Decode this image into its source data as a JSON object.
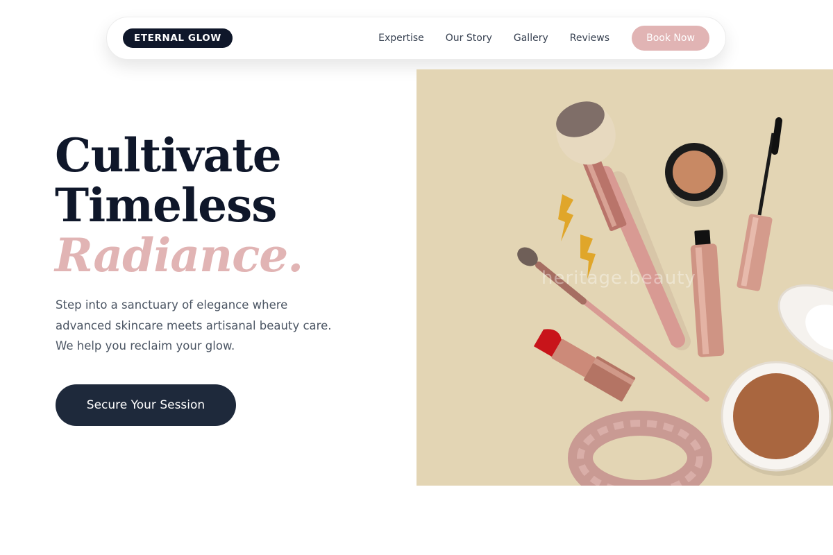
{
  "brand": {
    "name": "ETERNAL GLOW"
  },
  "nav": {
    "links": [
      "Expertise",
      "Our Story",
      "Gallery",
      "Reviews"
    ],
    "cta": "Book Now"
  },
  "hero": {
    "headline_line1": "Cultivate",
    "headline_line2": "Timeless",
    "headline_accent": "Radiance.",
    "subtitle_lines": [
      "Step into a sanctuary of elegance where",
      "advanced skincare meets artisanal beauty care.",
      "We help you reclaim your glow."
    ],
    "cta_label": "Secure Your Session",
    "image_watermark": "heritage.beauty"
  },
  "colors": {
    "navy": "#0f172a",
    "rose_accent": "#e1b4b4",
    "cta_dark": "#1e293b",
    "image_bg": "#e3d5b4"
  },
  "icons": [
    "makeup-brush-icon",
    "lipstick-icon",
    "mascara-icon",
    "compact-icon",
    "scrunchie-icon",
    "lightning-earring-icon"
  ]
}
